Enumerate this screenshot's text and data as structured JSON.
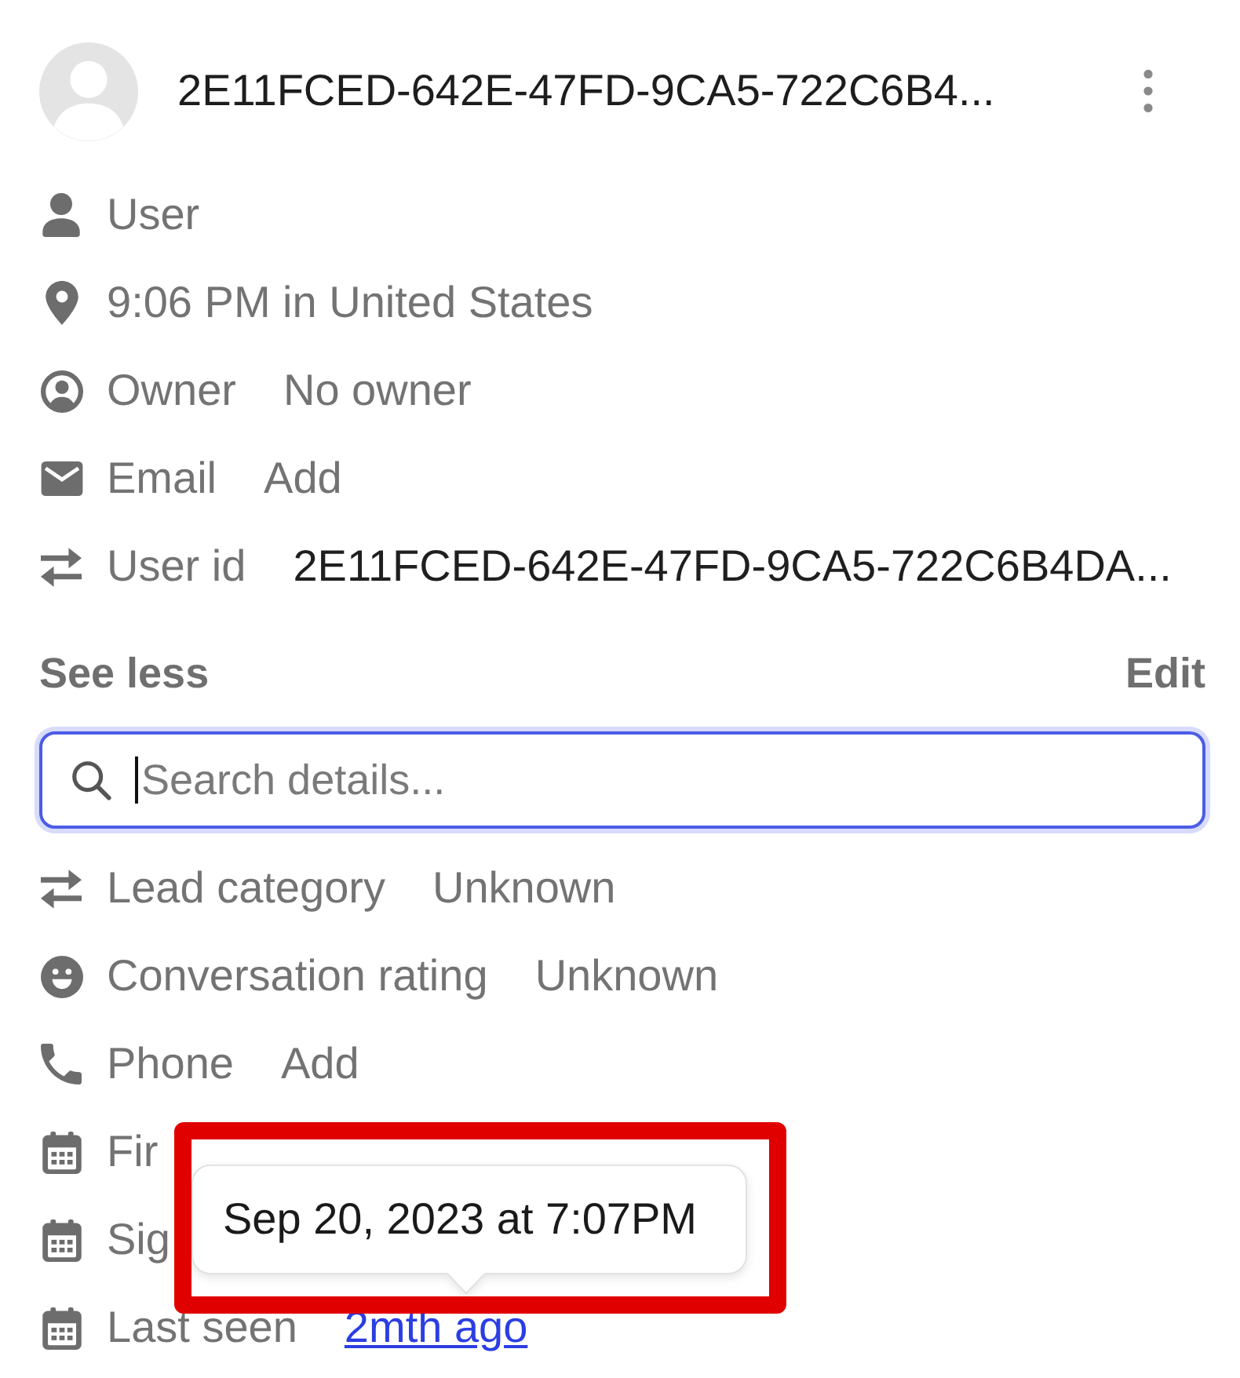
{
  "header": {
    "title": "2E11FCED-642E-47FD-9CA5-722C6B4..."
  },
  "summary": [
    {
      "kind": "user",
      "label": "User"
    },
    {
      "kind": "location",
      "label": "9:06 PM in United States"
    },
    {
      "kind": "owner",
      "label": "Owner",
      "value": "No owner"
    },
    {
      "kind": "email",
      "label": "Email",
      "value": "Add"
    },
    {
      "kind": "identifier",
      "label": "User id",
      "value": "2E11FCED-642E-47FD-9CA5-722C6B4DA..."
    }
  ],
  "actions": {
    "see_less": "See less",
    "edit": "Edit"
  },
  "search": {
    "placeholder": "Search details...",
    "focused": true
  },
  "details": [
    {
      "kind": "attribute",
      "label": "Lead category",
      "value": "Unknown",
      "hovered": false
    },
    {
      "kind": "rating",
      "label": "Conversation rating",
      "value": "Unknown",
      "hovered": false
    },
    {
      "kind": "phone",
      "label": "Phone",
      "value": "Add",
      "hovered": false
    },
    {
      "kind": "date",
      "label": "Fir"
    },
    {
      "kind": "date",
      "label": "Sig"
    },
    {
      "kind": "date",
      "label": "Last seen",
      "value": "2mth ago",
      "hovered": true
    }
  ],
  "tooltip": {
    "text": "Sep 20, 2023 at 7:07PM",
    "highlighted": true
  }
}
